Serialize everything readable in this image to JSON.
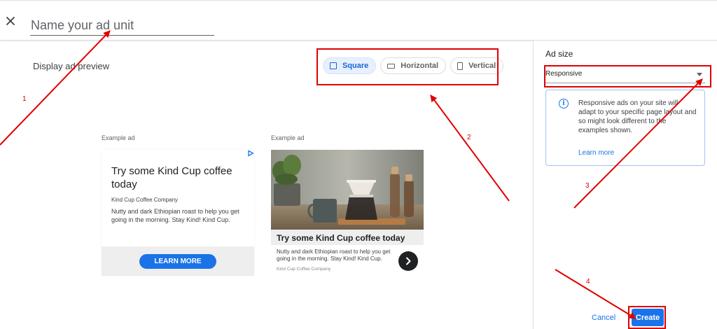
{
  "header": {
    "close_icon": "close-icon",
    "name_placeholder": "Name your ad unit"
  },
  "preview": {
    "title": "Display ad preview",
    "toggles": [
      {
        "label": "Square",
        "icon": "square-icon",
        "active": true
      },
      {
        "label": "Horizontal",
        "icon": "horizontal-rect-icon",
        "active": false
      },
      {
        "label": "Vertical",
        "icon": "vertical-rect-icon",
        "active": false
      }
    ]
  },
  "examples": {
    "square": {
      "label": "Example ad",
      "headline": "Try some Kind Cup coffee today",
      "advertiser": "Kind Cup Coffee Company",
      "description": "Nutty and dark Ethiopian roast to help you get going in the morning. Stay Kind! Kind Cup.",
      "cta": "LEARN MORE"
    },
    "image": {
      "label": "Example ad",
      "headline": "Try some Kind Cup coffee today",
      "description": "Nutty and dark Ethiopian roast to help you get going in the morning. Stay Kind! Kind Cup.",
      "advertiser": "Kind Cup Coffee Company"
    }
  },
  "sidebar": {
    "ad_size_label": "Ad size",
    "ad_size_value": "Responsive",
    "info_text": "Responsive ads on your site will adapt to your specific page layout and so might look different to the examples shown.",
    "info_link": "Learn more",
    "cancel": "Cancel",
    "create": "Create"
  },
  "annotations": [
    "1",
    "2",
    "3",
    "4"
  ],
  "colors": {
    "accent": "#1a73e8",
    "annotation": "#e00000",
    "toggle_active_bg": "#e8f0fe"
  }
}
